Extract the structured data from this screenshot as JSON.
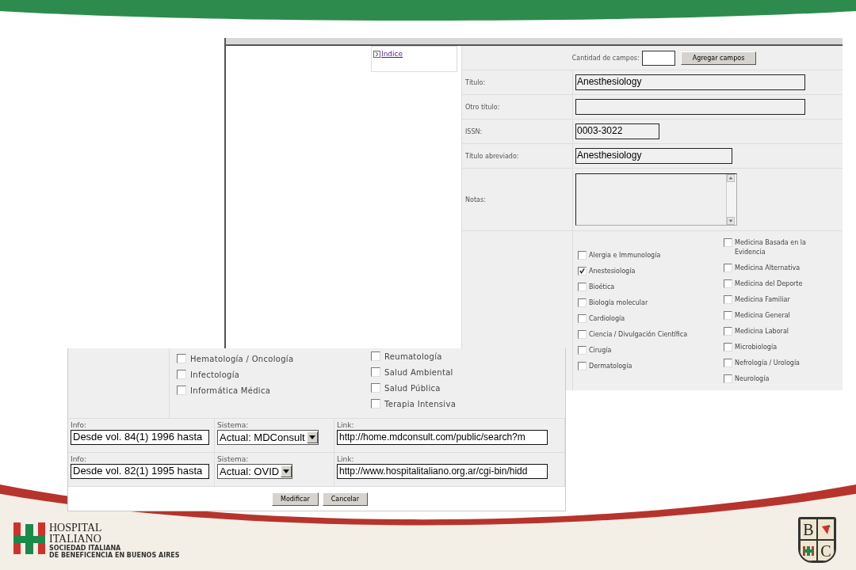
{
  "screen_1": {
    "index_link": "Indice",
    "count": {
      "label": "Cantidad de campos:",
      "button": "Agregar campos"
    },
    "fields": [
      {
        "label": "Título:",
        "kind": "wide",
        "value": "Anesthesiology"
      },
      {
        "label": "Otro título:",
        "kind": "wide"
      },
      {
        "label": "ISSN:",
        "kind": "short",
        "value": "0003-3022"
      },
      {
        "label": "Título abreviado:",
        "kind": "medium",
        "value": "Anesthesiology"
      },
      {
        "label": "Notas:",
        "kind": "textarea"
      }
    ],
    "subjects": {
      "column_1": [
        {
          "label": "Alergia e Immunología",
          "checked": false
        },
        {
          "label": "Anestesiología",
          "checked": true
        },
        {
          "label": "Bioética",
          "checked": false
        },
        {
          "label": "Biología molecular",
          "checked": false
        },
        {
          "label": "Cardiología",
          "checked": false
        },
        {
          "label": "Ciencia / Divulgación Científica",
          "checked": false
        },
        {
          "label": "Cirugía",
          "checked": false
        },
        {
          "label": "Dermatología",
          "checked": false
        }
      ],
      "column_2": [
        {
          "label": "Medicina Basada en la Evidencia",
          "checked": false
        },
        {
          "label": "Medicina Alternativa",
          "checked": false
        },
        {
          "label": "Medicina del Deporte",
          "checked": false
        },
        {
          "label": "Medicina Familiar",
          "checked": false
        },
        {
          "label": "Medicina General",
          "checked": false
        },
        {
          "label": "Medicina Laboral",
          "checked": false
        },
        {
          "label": "Microbiología",
          "checked": false
        },
        {
          "label": "Nefrología / Urología",
          "checked": false
        },
        {
          "label": "Neurología",
          "checked": false
        }
      ]
    }
  },
  "screen_2": {
    "subjects": {
      "column_1": [
        {
          "label": "Hematología / Oncología",
          "checked": false
        },
        {
          "label": "Infectología",
          "checked": false
        },
        {
          "label": "Informática Médica",
          "checked": false
        }
      ],
      "column_2": [
        {
          "label": "Reumatología",
          "checked": false
        },
        {
          "label": "Salud Ambiental",
          "checked": false
        },
        {
          "label": "Salud Pública",
          "checked": false
        },
        {
          "label": "Terapia Intensiva",
          "checked": false
        }
      ]
    },
    "links": [
      {
        "info_label": "Info:",
        "info": "Desde vol. 84(1) 1996 hasta",
        "system_label": "Sistema:",
        "system": "Actual: MDConsult",
        "link_label": "Link:",
        "link": "http://home.mdconsult.com/public/search?m"
      },
      {
        "info_label": "Info:",
        "info": "Desde vol. 82(1) 1995 hasta",
        "system_label": "Sistema:",
        "system": "Actual: OVID",
        "link_label": "Link:",
        "link": "http://www.hospitalitaliano.org.ar/cgi-bin/hidd"
      }
    ],
    "buttons": [
      "Modificar",
      "Cancelar"
    ]
  },
  "logo": {
    "name_lines": [
      "HOSPITAL",
      "ITALIANO"
    ],
    "tagline_lines": [
      "SOCIEDAD ITALIANA",
      "DE BENEFICENCIA EN BUENOS AIRES"
    ]
  },
  "crest": {
    "letters": [
      "B",
      "C"
    ]
  }
}
